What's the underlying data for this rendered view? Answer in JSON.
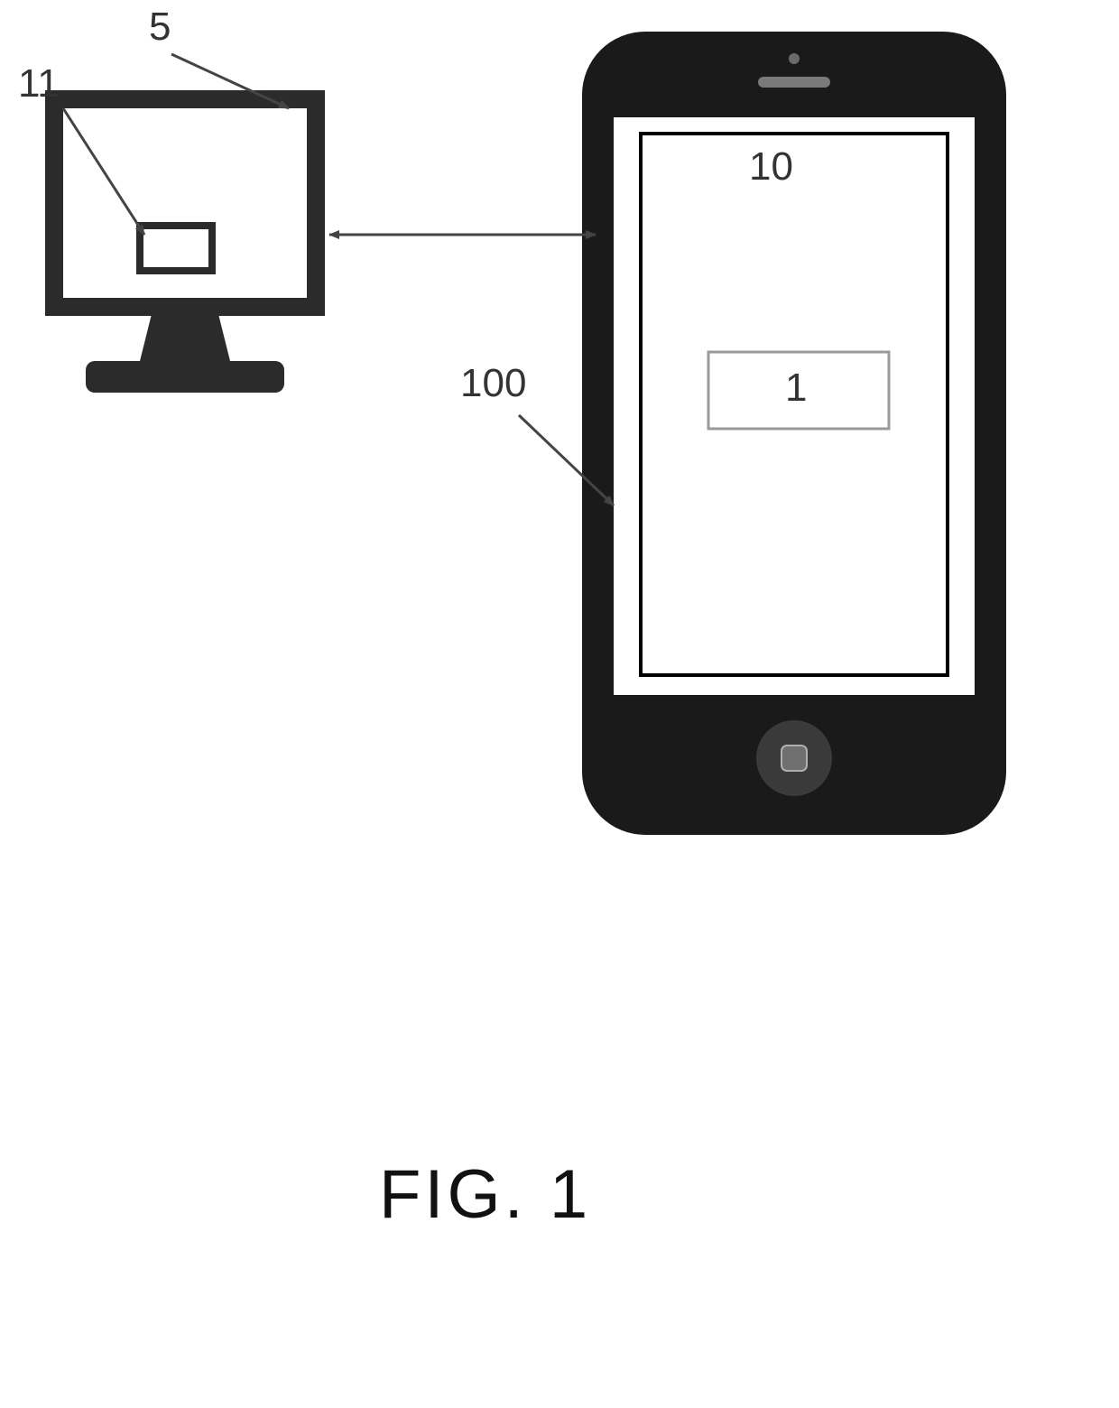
{
  "labels": {
    "monitor_ref": "5",
    "monitor_inner_ref": "11",
    "phone_screen_ref": "10",
    "phone_box_ref": "1",
    "system_ref": "100"
  },
  "caption": "FIG.  1"
}
